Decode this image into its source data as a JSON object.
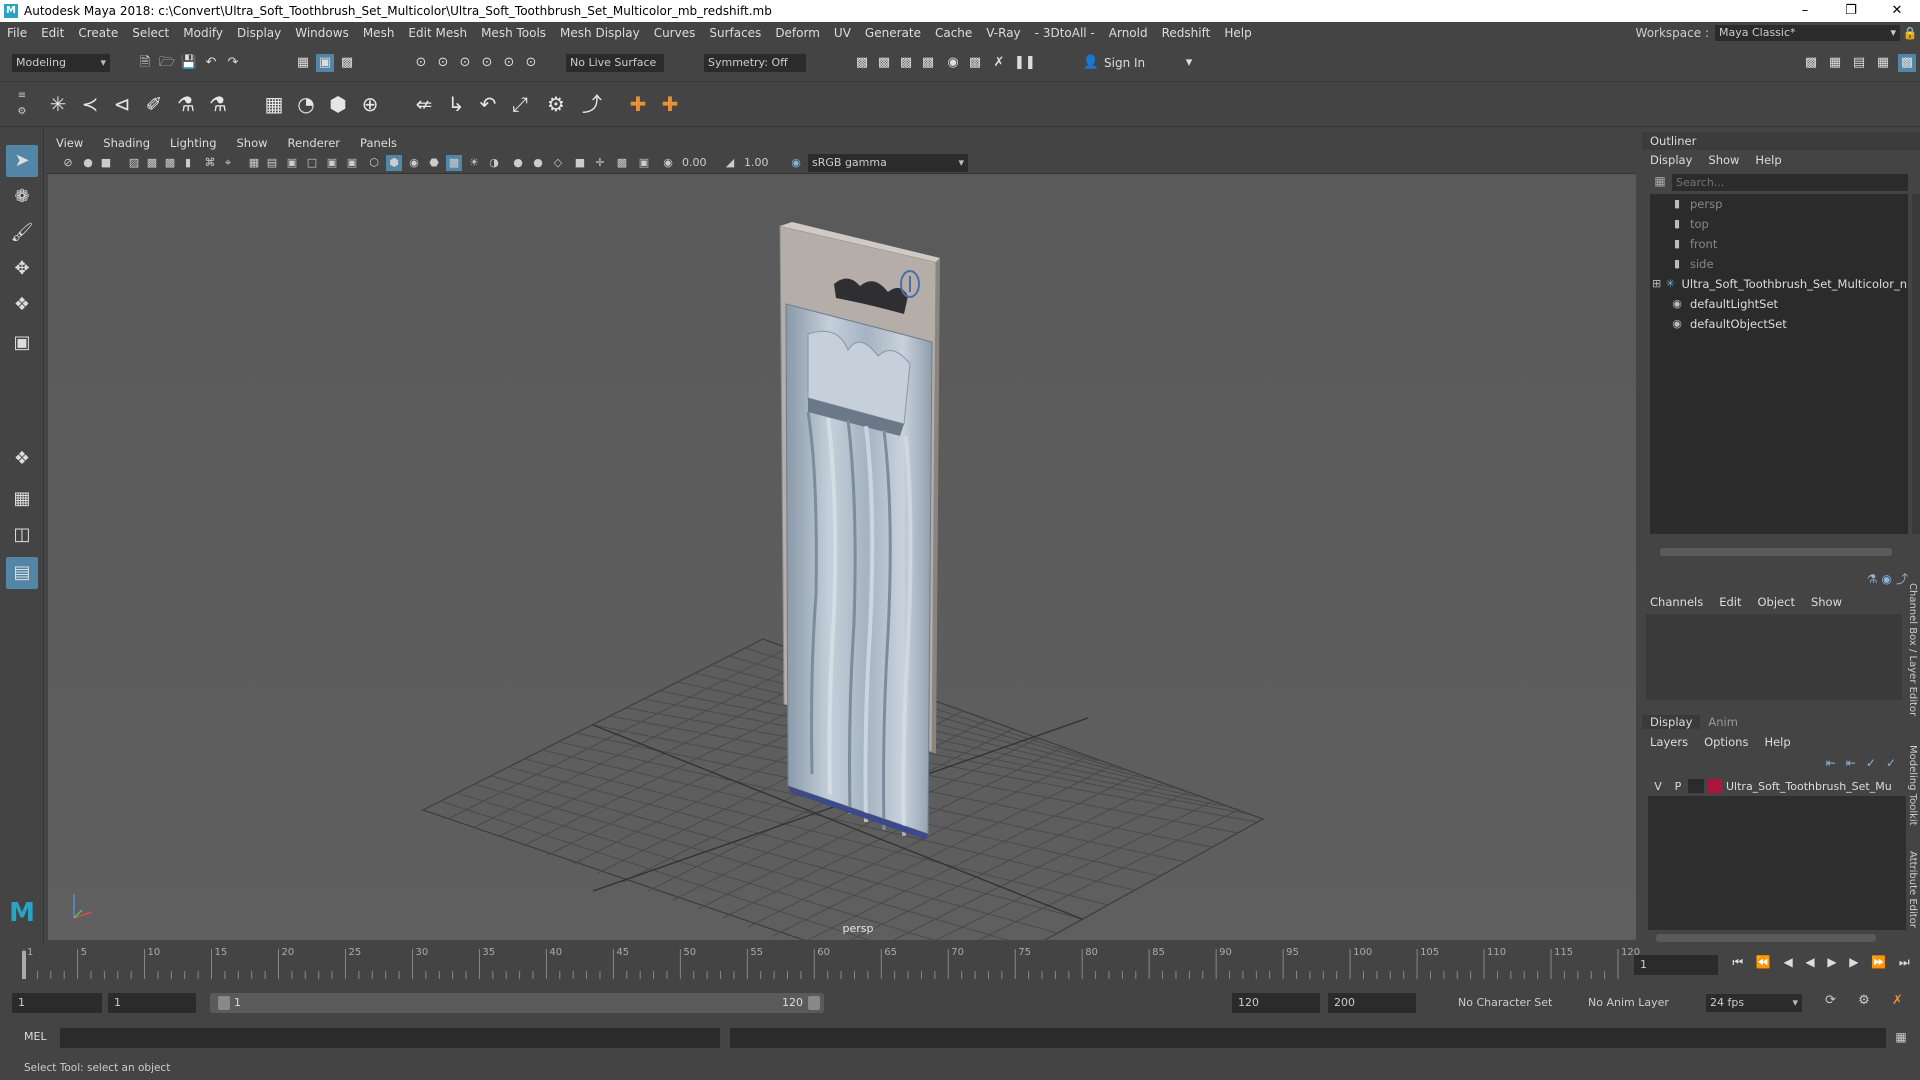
{
  "window": {
    "title": "Autodesk Maya 2018: c:\\Convert\\Ultra_Soft_Toothbrush_Set_Multicolor\\Ultra_Soft_Toothbrush_Set_Multicolor_mb_redshift.mb",
    "app_icon": "M",
    "minimize": "–",
    "maximize": "❐",
    "close": "✕"
  },
  "menubar": {
    "items": [
      "File",
      "Edit",
      "Create",
      "Select",
      "Modify",
      "Display",
      "Windows",
      "Mesh",
      "Edit Mesh",
      "Mesh Tools",
      "Mesh Display",
      "Curves",
      "Surfaces",
      "Deform",
      "UV",
      "Generate",
      "Cache",
      "V-Ray",
      "- 3DtoAll -",
      "Arnold",
      "Redshift",
      "Help"
    ],
    "workspace_label": "Workspace :",
    "workspace_value": "Maya Classic*"
  },
  "statusline": {
    "mode": "Modeling",
    "live_surface": "No Live Surface",
    "symmetry": "Symmetry: Off",
    "sign_in": "Sign In"
  },
  "panel": {
    "menus": [
      "View",
      "Shading",
      "Lighting",
      "Show",
      "Renderer",
      "Panels"
    ],
    "exposure": "0.00",
    "gamma": "1.00",
    "color_space": "sRGB gamma",
    "camera_label": "persp"
  },
  "outliner": {
    "title": "Outliner",
    "menus": [
      "Display",
      "Show",
      "Help"
    ],
    "search_placeholder": "Search...",
    "items": [
      {
        "label": "persp",
        "dim": true,
        "icon": "camera-icon"
      },
      {
        "label": "top",
        "dim": true,
        "icon": "camera-icon"
      },
      {
        "label": "front",
        "dim": true,
        "icon": "camera-icon"
      },
      {
        "label": "side",
        "dim": true,
        "icon": "camera-icon"
      },
      {
        "label": "Ultra_Soft_Toothbrush_Set_Multicolor_n",
        "dim": false,
        "icon": "group-icon"
      },
      {
        "label": "defaultLightSet",
        "dim": false,
        "icon": "set-icon"
      },
      {
        "label": "defaultObjectSet",
        "dim": false,
        "icon": "set-icon"
      }
    ]
  },
  "channelbox": {
    "menus": [
      "Channels",
      "Edit",
      "Object",
      "Show"
    ],
    "side_tab": "Channel Box / Layer Editor"
  },
  "layers": {
    "tabs": [
      "Display",
      "Anim"
    ],
    "menus": [
      "Layers",
      "Options",
      "Help"
    ],
    "row": {
      "v": "V",
      "p": "P",
      "name": "Ultra_Soft_Toothbrush_Set_Mu"
    },
    "layer_color": "#b0143c",
    "side_tab_1": "Modeling Toolkit",
    "side_tab_2": "Attribute Editor"
  },
  "timeline": {
    "ticks": [
      "1",
      "5",
      "10",
      "15",
      "20",
      "25",
      "30",
      "35",
      "40",
      "45",
      "50",
      "55",
      "60",
      "65",
      "70",
      "75",
      "80",
      "85",
      "90",
      "95",
      "100",
      "105",
      "110",
      "115",
      "120"
    ],
    "current_frame": "1"
  },
  "range": {
    "start": "1",
    "playback_start": "1",
    "slider_start": "1",
    "slider_end": "120",
    "playback_end": "120",
    "end": "200",
    "character_set": "No Character Set",
    "anim_layer": "No Anim Layer",
    "fps": "24 fps"
  },
  "cmdline": {
    "label": "MEL"
  },
  "helpline": {
    "text": "Select Tool: select an object"
  }
}
